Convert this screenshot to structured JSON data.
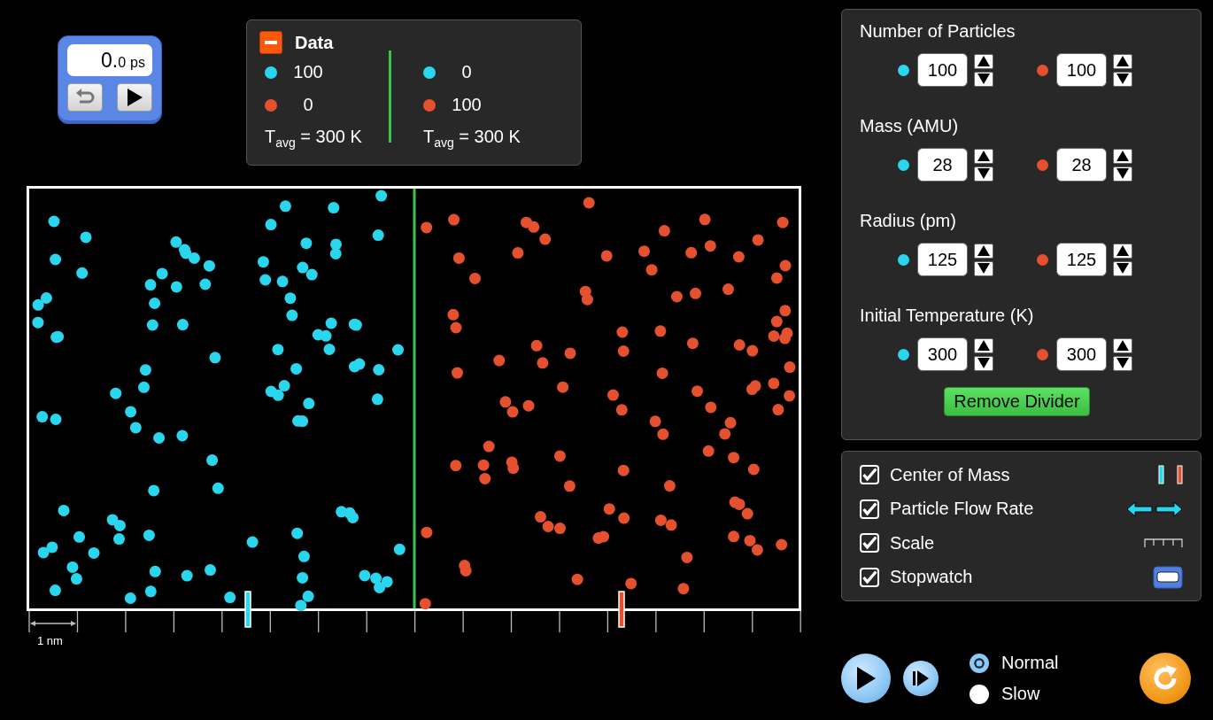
{
  "species": [
    {
      "color": "#29d6ee"
    },
    {
      "color": "#e5502f"
    }
  ],
  "stopwatch": {
    "reading_whole": "0.",
    "reading_fraction": "0",
    "unit": "ps"
  },
  "data_panel": {
    "title": "Data",
    "expanded": true,
    "sides": [
      {
        "counts": [
          "100",
          "0"
        ],
        "temperature": "T$_{avg}$ = 300 K"
      },
      {
        "counts": [
          "0",
          "100"
        ],
        "temperature": "T$_{avg}$ = 300 K"
      }
    ]
  },
  "container": {
    "divider": true,
    "scale_label": "1 nm"
  },
  "parameters": [
    {
      "label": "Number of Particles",
      "values": [
        "100",
        "100"
      ]
    },
    {
      "label": "Mass (AMU)",
      "values": [
        "28",
        "28"
      ]
    },
    {
      "label": "Radius (pm)",
      "values": [
        "125",
        "125"
      ]
    },
    {
      "label": "Initial Temperature (K)",
      "values": [
        "300",
        "300"
      ]
    }
  ],
  "remove_divider_button": "Remove Divider",
  "options": [
    {
      "kind": "center_of_mass",
      "label": "Center of Mass",
      "checked": true
    },
    {
      "kind": "flow_rate",
      "label": "Particle Flow Rate",
      "checked": true
    },
    {
      "kind": "scale",
      "label": "Scale",
      "checked": true
    },
    {
      "kind": "stopwatch",
      "label": "Stopwatch",
      "checked": true
    }
  ],
  "speed": [
    {
      "label": "Normal",
      "selected": true
    },
    {
      "label": "Slow",
      "selected": false
    }
  ]
}
